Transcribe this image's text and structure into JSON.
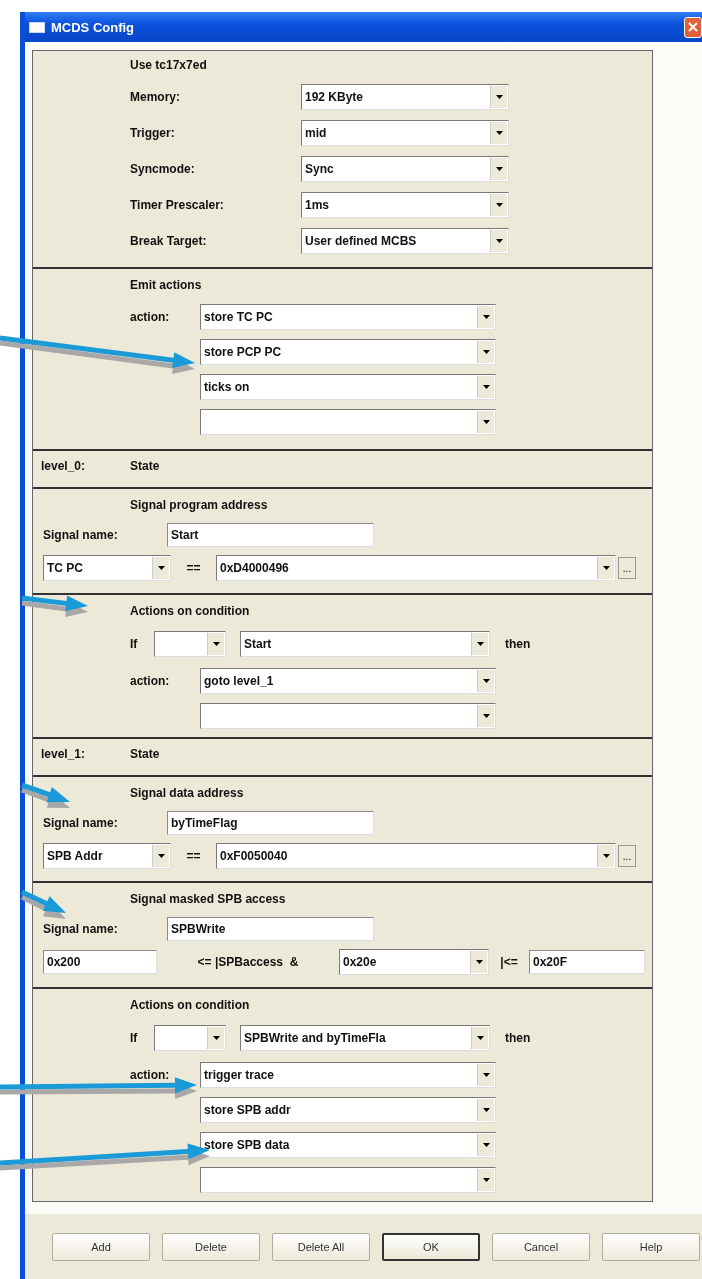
{
  "window": {
    "title": "MCDS Config"
  },
  "sections": [
    {
      "kind": "settings",
      "title": "Use tc17x7ed",
      "rows": [
        {
          "label": "Memory:",
          "value": "192 KByte"
        },
        {
          "label": "Trigger:",
          "value": "mid"
        },
        {
          "label": "Syncmode:",
          "value": "Sync"
        },
        {
          "label": "Timer Prescaler:",
          "value": "1ms"
        },
        {
          "label": "Break Target:",
          "value": "User defined MCBS"
        }
      ]
    },
    {
      "kind": "actions",
      "title": "Emit actions",
      "action_label": "action:",
      "actions": [
        {
          "kind": "filled",
          "value": "store TC PC"
        },
        {
          "kind": "filled",
          "value": "store PCP PC"
        },
        {
          "kind": "filled",
          "value": "ticks on"
        },
        {
          "kind": "blank"
        }
      ]
    },
    {
      "kind": "level",
      "label": "level_0:",
      "text": "State"
    },
    {
      "kind": "signal",
      "title": "Signal program address",
      "name_label": "Signal name:",
      "name_value": "Start",
      "source": "TC PC",
      "operator": "==",
      "address": "0xD4000496",
      "browse": "..."
    },
    {
      "kind": "condition",
      "title": "Actions on condition",
      "if_label": "If",
      "operand": "Start",
      "then_label": "then",
      "action_label": "action:",
      "actions": [
        {
          "kind": "filled",
          "value": "goto level_1"
        },
        {
          "kind": "blank"
        }
      ]
    },
    {
      "kind": "level",
      "label": "level_1:",
      "text": "State"
    },
    {
      "kind": "signal",
      "title": "Signal data address",
      "name_label": "Signal name:",
      "name_value": "byTimeFlag",
      "source": "SPB Addr",
      "operator": "==",
      "address": "0xF0050040",
      "browse": "..."
    },
    {
      "kind": "masked",
      "title": "Signal masked SPB access",
      "name_label": "Signal name:",
      "name_value": "SPBWrite",
      "low": "0x200",
      "expr": "<= |SPBaccess  &",
      "mask": "0x20e",
      "close": "|<=",
      "high": "0x20F"
    },
    {
      "kind": "condition",
      "title": "Actions on condition",
      "if_label": "If",
      "operand": "SPBWrite and byTimeFla",
      "then_label": "then",
      "action_label": "action:",
      "actions": [
        {
          "kind": "filled",
          "value": "trigger trace"
        },
        {
          "kind": "filled",
          "value": "store SPB addr"
        },
        {
          "kind": "filled",
          "value": "store SPB data"
        },
        {
          "kind": "blank"
        }
      ]
    }
  ],
  "buttons": [
    {
      "label": "Add",
      "default": false
    },
    {
      "label": "Delete",
      "default": false
    },
    {
      "label": "Delete All",
      "default": false
    },
    {
      "label": "OK",
      "default": true
    },
    {
      "label": "Cancel",
      "default": false
    },
    {
      "label": "Help",
      "default": false
    }
  ]
}
